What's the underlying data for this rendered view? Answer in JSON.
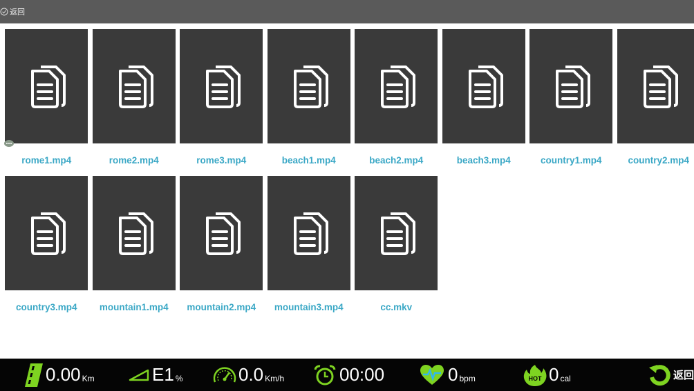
{
  "topbar": {
    "back_label": "返回"
  },
  "files": [
    {
      "name": "rome1.mp4"
    },
    {
      "name": "rome2.mp4"
    },
    {
      "name": "rome3.mp4"
    },
    {
      "name": "beach1.mp4"
    },
    {
      "name": "beach2.mp4"
    },
    {
      "name": "beach3.mp4"
    },
    {
      "name": "country1.mp4"
    },
    {
      "name": "country2.mp4"
    },
    {
      "name": "country3.mp4"
    },
    {
      "name": "mountain1.mp4"
    },
    {
      "name": "mountain2.mp4"
    },
    {
      "name": "mountain3.mp4"
    },
    {
      "name": "cc.mkv"
    }
  ],
  "statusbar": {
    "distance": {
      "value": "0.00",
      "unit": "Km"
    },
    "incline": {
      "value": "E1",
      "unit": "%"
    },
    "speed": {
      "value": "0.0",
      "unit": "Km/h"
    },
    "time": {
      "value": "00:00"
    },
    "heart_rate": {
      "value": "0",
      "unit": "bpm"
    },
    "calories": {
      "value": "0",
      "unit": "cal",
      "badge": "HOT"
    },
    "back_label": "返回"
  },
  "colors": {
    "topbar": "#5a5a5a",
    "tile": "#3a3a3a",
    "filename": "#3ba8c6",
    "statusbar": "#050505",
    "accent_green": "#7ed321",
    "accent_blue": "#2fb7f0"
  }
}
